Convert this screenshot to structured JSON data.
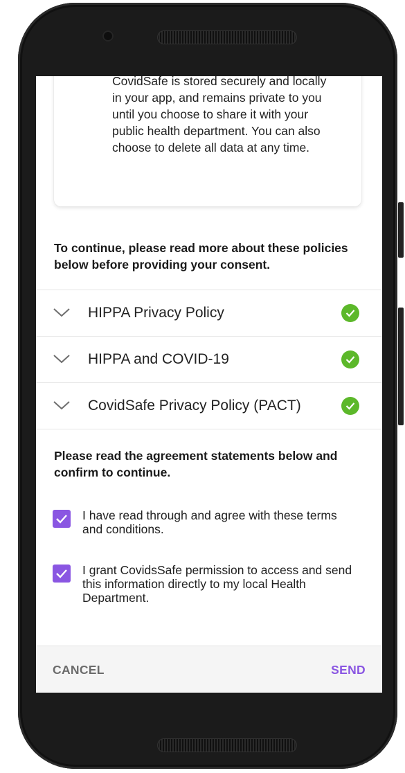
{
  "info_card": {
    "text": "CovidSafe is stored securely and locally in your app, and remains private to you until you choose to share it with your public health department. You can also choose to delete all data at any time."
  },
  "policies": {
    "intro": "To continue, please read more about these policies below before providing your consent.",
    "items": [
      {
        "label": "HIPPA Privacy Policy",
        "status": "checked"
      },
      {
        "label": "HIPPA and COVID-19",
        "status": "checked"
      },
      {
        "label": "CovidSafe Privacy Policy (PACT)",
        "status": "checked"
      }
    ]
  },
  "agreement": {
    "intro": "Please read the agreement statements below and confirm to continue.",
    "items": [
      {
        "text": "I have read through and agree with these terms and conditions.",
        "checked": true
      },
      {
        "text": "I grant CovidsSafe permission to access and send this information directly to my local Health Department.",
        "checked": true
      }
    ]
  },
  "actions": {
    "cancel_label": "CANCEL",
    "send_label": "SEND"
  },
  "colors": {
    "accent": "#8a56e2",
    "check_green": "#5cb82a",
    "phone_frame": "#1b1b1b"
  },
  "icons": {
    "expand": "chevron-down-icon",
    "status": "checkmark-circle-icon",
    "checkbox": "checkbox-checked-icon"
  }
}
